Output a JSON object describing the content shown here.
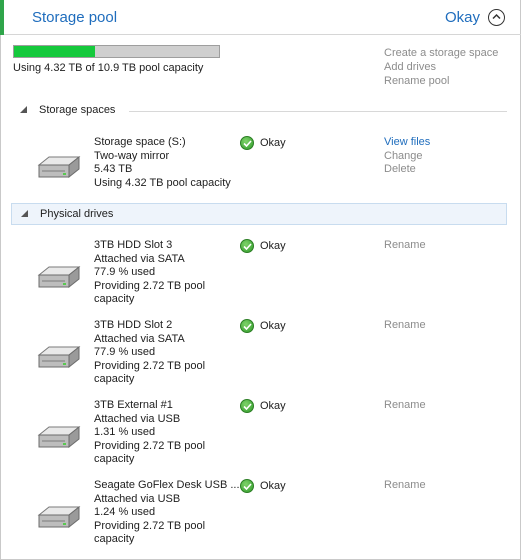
{
  "header": {
    "title": "Storage pool",
    "status": "Okay"
  },
  "pool": {
    "capacity_text": "Using 4.32 TB of 10.9 TB pool capacity",
    "used_fraction": 0.396,
    "actions": [
      "Create a storage space",
      "Add drives",
      "Rename pool"
    ]
  },
  "sections": {
    "storage_spaces": "Storage spaces",
    "physical_drives": "Physical drives"
  },
  "storage_space": {
    "name": "Storage space (S:)",
    "type": "Two-way mirror",
    "size": "5.43 TB",
    "usage": "Using 4.32 TB pool capacity",
    "status": "Okay",
    "actions": [
      "View files",
      "Change",
      "Delete"
    ]
  },
  "drives": [
    {
      "name": "3TB HDD Slot 3",
      "connection": "Attached via SATA",
      "used": "77.9 % used",
      "providing": "Providing 2.72 TB pool capacity",
      "status": "Okay",
      "action": "Rename"
    },
    {
      "name": "3TB HDD Slot 2",
      "connection": "Attached via SATA",
      "used": "77.9 % used",
      "providing": "Providing 2.72 TB pool capacity",
      "status": "Okay",
      "action": "Rename"
    },
    {
      "name": "3TB External #1",
      "connection": "Attached via USB",
      "used": "1.31 % used",
      "providing": "Providing 2.72 TB pool capacity",
      "status": "Okay",
      "action": "Rename"
    },
    {
      "name": "Seagate GoFlex Desk USB ...",
      "connection": "Attached via USB",
      "used": "1.24 % used",
      "providing": "Providing 2.72 TB pool capacity",
      "status": "Okay",
      "action": "Rename"
    }
  ],
  "icons": {
    "collapse": "chevron-up-circle-icon",
    "drive": "hard-drive-icon",
    "status": "green-check-icon",
    "section_expanded": "triangle-expanded-icon"
  },
  "colors": {
    "accent": "#2fa54a",
    "link": "#1f6dbd",
    "capacity_fill": "#15c93c",
    "muted": "#8c8c8c"
  }
}
